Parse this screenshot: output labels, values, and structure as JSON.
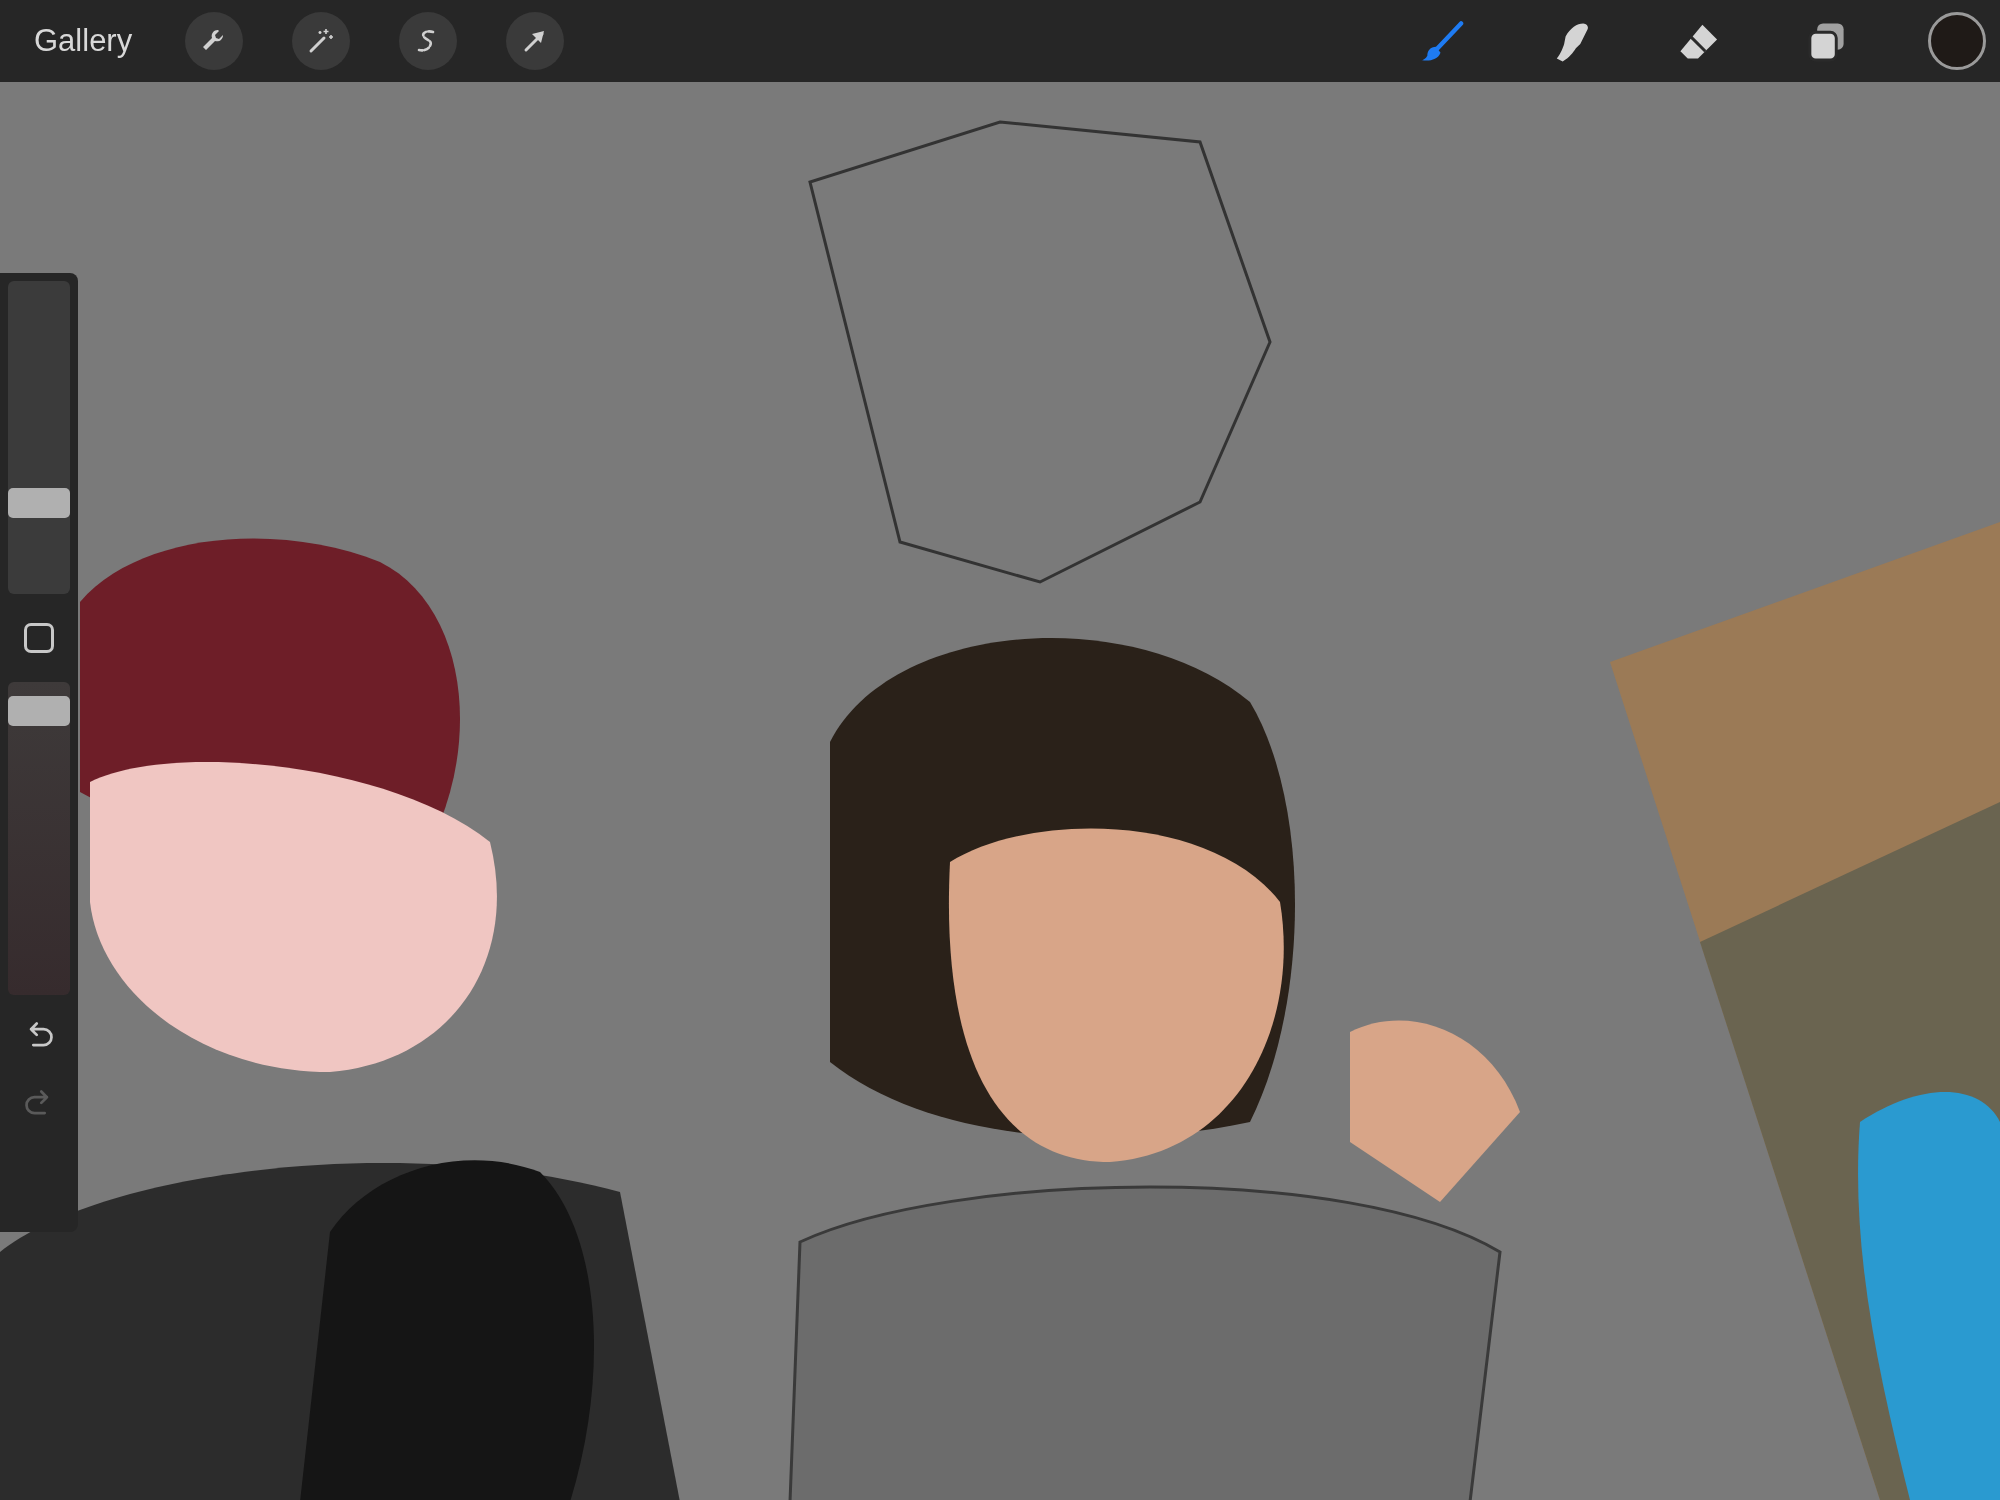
{
  "toolbar": {
    "gallery": "Gallery",
    "actions": [
      {
        "kind": "wrench"
      },
      {
        "kind": "wand"
      },
      {
        "kind": "select"
      },
      {
        "kind": "transform"
      }
    ],
    "tools": [
      {
        "kind": "brush",
        "selected": true
      },
      {
        "kind": "smudge",
        "selected": false
      },
      {
        "kind": "eraser",
        "selected": false
      },
      {
        "kind": "layers",
        "selected": false
      }
    ],
    "color_swatch": {
      "color": "#1f1a17"
    }
  },
  "sidebar": {
    "size_slider": {
      "level": 0.27
    },
    "opacity_slider": {
      "level": 0.95
    },
    "undo": {
      "disabled": false
    },
    "redo": {
      "disabled": true
    }
  }
}
